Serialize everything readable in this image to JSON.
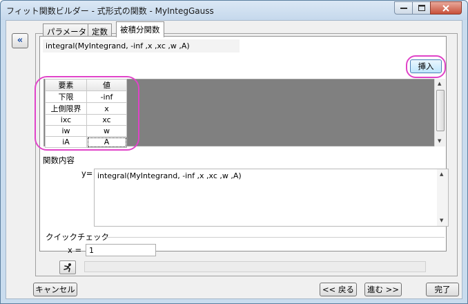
{
  "window": {
    "title": "フィット関数ビルダー - 式形式の関数 - MyIntegGauss"
  },
  "nav": {
    "collapse_label": "«"
  },
  "tabs": [
    {
      "label": "パラメータ",
      "active": false
    },
    {
      "label": "定数",
      "active": false
    },
    {
      "label": "被積分関数",
      "active": true
    }
  ],
  "integral": {
    "expression": "integral(MyIntegrand, -inf ,x ,xc ,w ,A)",
    "insert_label": "挿入"
  },
  "grid": {
    "headers": [
      "要素",
      "値"
    ],
    "rows": [
      [
        "下限",
        "-inf"
      ],
      [
        "上側限界",
        "x"
      ],
      [
        "ixc",
        "xc"
      ],
      [
        "iw",
        "w"
      ],
      [
        "iA",
        "A"
      ]
    ]
  },
  "function_body": {
    "section_label": "関数内容",
    "prefix": "y=",
    "text": "integral(MyIntegrand, -inf ,x ,xc ,w ,A)"
  },
  "quick_check": {
    "label": "クイックチェック",
    "x_label": "x =",
    "x_value": "1"
  },
  "footer": {
    "cancel_label": "キャンセル",
    "back_label": "<< 戻る",
    "next_label": "進む >>",
    "finish_label": "完了"
  },
  "colors": {
    "highlight": "#e043c8",
    "grid_background": "#808080"
  }
}
